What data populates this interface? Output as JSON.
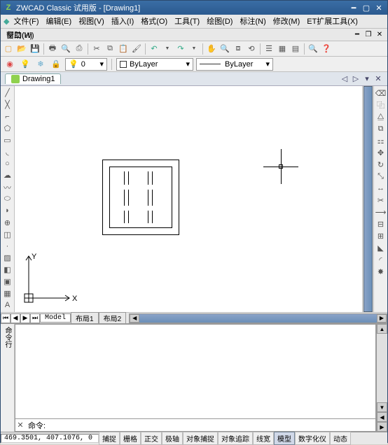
{
  "app": {
    "title": "ZWCAD Classic 试用版 - [Drawing1]"
  },
  "menu": {
    "items": [
      "文件(F)",
      "编辑(E)",
      "视图(V)",
      "插入(I)",
      "格式(O)",
      "工具(T)",
      "绘图(D)",
      "标注(N)",
      "修改(M)",
      "ET扩展工具(X)",
      "窗口(W)"
    ],
    "help": "帮助(H)"
  },
  "doctab": {
    "name": "Drawing1"
  },
  "layer": {
    "current": "ByLayer",
    "linetype": "ByLayer"
  },
  "layout": {
    "model": "Model",
    "l1": "布局1",
    "l2": "布局2"
  },
  "cmd": {
    "prompt": "命令:"
  },
  "status": {
    "coords": "469.3501, 407.1076, 0",
    "btns": [
      "捕捉",
      "栅格",
      "正交",
      "极轴",
      "对象捕捉",
      "对象追踪",
      "线宽",
      "模型",
      "数字化仪",
      "动态"
    ]
  },
  "axis": {
    "x": "X",
    "y": "Y"
  }
}
